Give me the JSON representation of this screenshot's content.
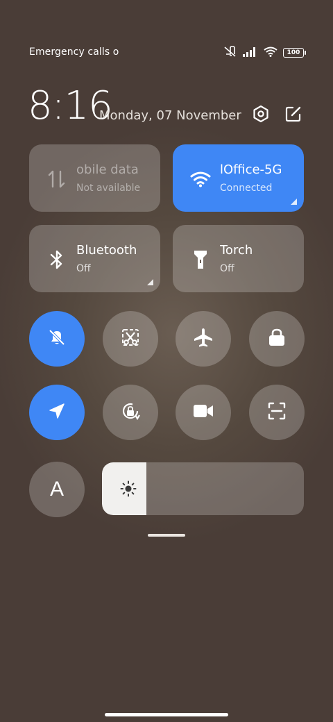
{
  "status_bar": {
    "text": "Emergency calls o",
    "battery": "100",
    "icons": [
      "muted-icon",
      "signal-icon",
      "wifi-icon",
      "battery-icon"
    ]
  },
  "header": {
    "time": "8:16",
    "date": "Monday, 07 November",
    "icons": [
      "settings-icon",
      "edit-icon"
    ]
  },
  "tiles": [
    {
      "id": "mobile-data",
      "icon": "data-arrows-icon",
      "title": "obile data",
      "subtitle": "Not available",
      "state": "disabled"
    },
    {
      "id": "wifi",
      "icon": "wifi-icon",
      "title": "lOffice-5G",
      "subtitle": "Connected",
      "state": "active"
    },
    {
      "id": "bluetooth",
      "icon": "bluetooth-icon",
      "title": "Bluetooth",
      "subtitle": "Off",
      "state": "off"
    },
    {
      "id": "torch",
      "icon": "torch-icon",
      "title": "Torch",
      "subtitle": "Off",
      "state": "off"
    }
  ],
  "toggles": [
    {
      "id": "silent",
      "icon": "bell-off-icon",
      "active": true
    },
    {
      "id": "screenshot",
      "icon": "scissors-icon",
      "active": false
    },
    {
      "id": "airplane",
      "icon": "airplane-icon",
      "active": false
    },
    {
      "id": "lock",
      "icon": "lock-icon",
      "active": false
    },
    {
      "id": "location",
      "icon": "location-icon",
      "active": true
    },
    {
      "id": "rotation-lock",
      "icon": "rotation-lock-icon",
      "active": false
    },
    {
      "id": "screen-record",
      "icon": "video-camera-icon",
      "active": false
    },
    {
      "id": "scanner",
      "icon": "scan-icon",
      "active": false
    }
  ],
  "auto_brightness_label": "A",
  "brightness": {
    "level": 0.22,
    "icon": "sun-icon"
  },
  "colors": {
    "accent": "#3f87f5",
    "tile": "rgba(255,255,255,0.22)"
  }
}
